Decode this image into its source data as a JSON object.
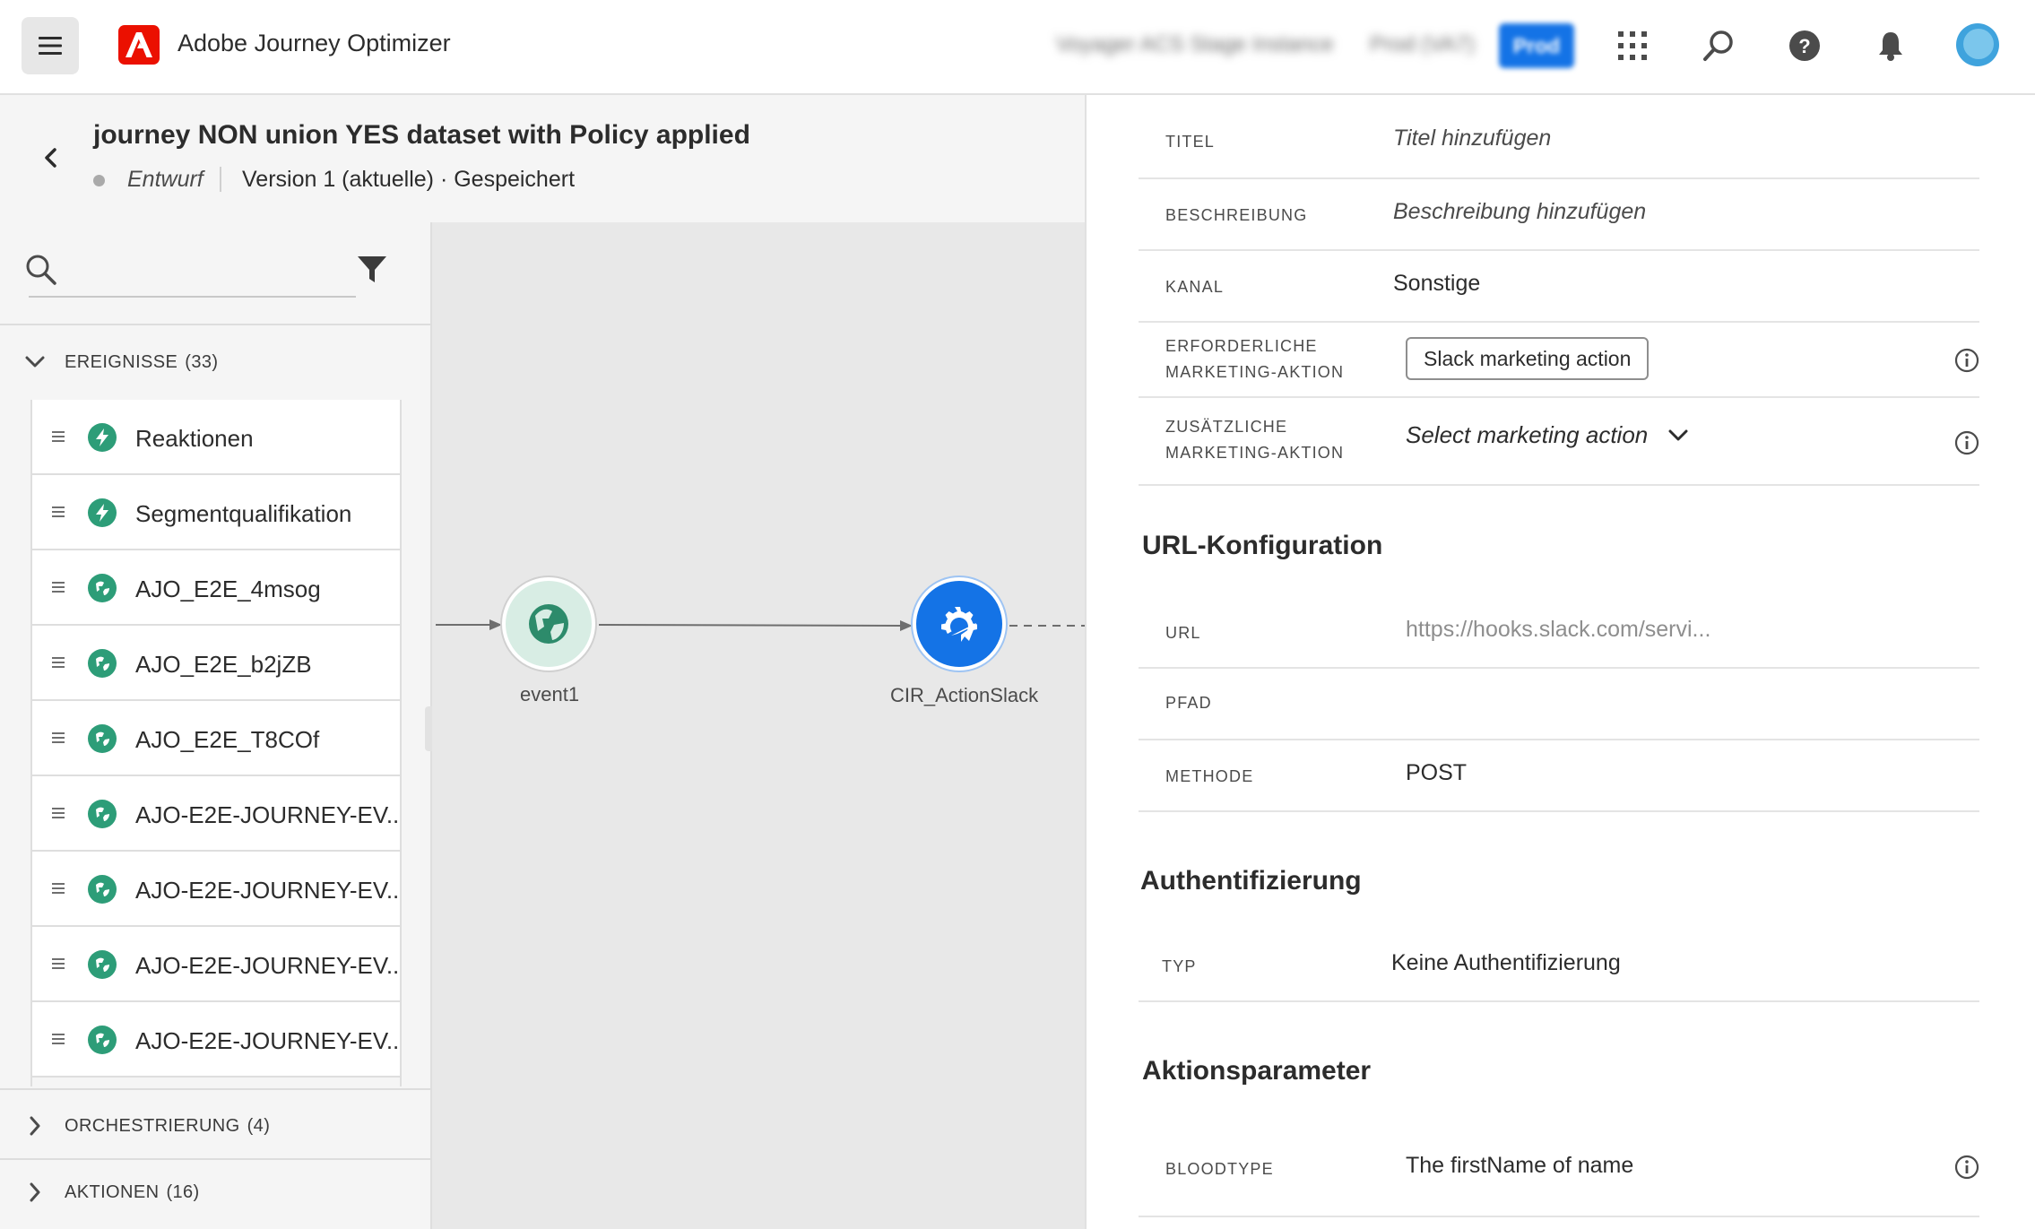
{
  "app": {
    "title": "Adobe Journey Optimizer",
    "logo_letter": "A",
    "accent_color": "#1473e6",
    "brand_color": "#eb1000",
    "org_name": "Voyager ACS Stage Instance",
    "sandbox": "Prod (VA7)",
    "env_badge": "Prod"
  },
  "journey": {
    "title": "journey NON union YES dataset with Policy applied",
    "status": "Entwurf",
    "version": "Version 1 (aktuelle) · Gespeichert"
  },
  "palette": {
    "search_placeholder": "",
    "sections": [
      {
        "label": "EREIGNISSE",
        "count": "(33)",
        "expanded": true
      },
      {
        "label": "ORCHESTRIERUNG",
        "count": "(4)",
        "expanded": false
      },
      {
        "label": "AKTIONEN",
        "count": "(16)",
        "expanded": false
      }
    ],
    "events": [
      {
        "label": "Reaktionen",
        "icon": "bolt-icon"
      },
      {
        "label": "Segmentqualifikation",
        "icon": "bolt-icon"
      },
      {
        "label": "AJO_E2E_4msog",
        "icon": "globe-icon"
      },
      {
        "label": "AJO_E2E_b2jZB",
        "icon": "globe-icon"
      },
      {
        "label": "AJO_E2E_T8COf",
        "icon": "globe-icon"
      },
      {
        "label": "AJO-E2E-JOURNEY-EV...",
        "icon": "globe-icon"
      },
      {
        "label": "AJO-E2E-JOURNEY-EV...",
        "icon": "globe-icon"
      },
      {
        "label": "AJO-E2E-JOURNEY-EV...",
        "icon": "globe-icon"
      },
      {
        "label": "AJO-E2E-JOURNEY-EV...",
        "icon": "globe-icon"
      }
    ]
  },
  "canvas": {
    "nodes": [
      {
        "label": "event1",
        "type": "event",
        "icon": "globe-icon"
      },
      {
        "label": "CIR_ActionSlack",
        "type": "action",
        "icon": "custom-action-icon"
      }
    ]
  },
  "properties": {
    "rows": [
      {
        "label": "TITEL",
        "value": "Titel hinzufügen"
      },
      {
        "label": "BESCHREIBUNG",
        "value": "Beschreibung hinzufügen"
      },
      {
        "label": "KANAL",
        "value": "Sonstige"
      },
      {
        "label": "ERFORDERLICHE MARKETING-AKTION",
        "value": "Slack marketing action"
      },
      {
        "label": "ZUSÄTZLICHE MARKETING-AKTION",
        "value": "Select marketing action"
      }
    ],
    "url_section": {
      "title": "URL-Konfiguration",
      "rows": [
        {
          "label": "URL",
          "value": "https://hooks.slack.com/servi..."
        },
        {
          "label": "PFAD",
          "value": ""
        },
        {
          "label": "METHODE",
          "value": "POST"
        }
      ]
    },
    "auth_section": {
      "title": "Authentifizierung",
      "rows": [
        {
          "label": "TYP",
          "value": "Keine Authentifizierung"
        }
      ]
    },
    "params_section": {
      "title": "Aktionsparameter",
      "rows": [
        {
          "label": "BLOODTYPE",
          "value": "The firstName of name"
        }
      ]
    }
  }
}
